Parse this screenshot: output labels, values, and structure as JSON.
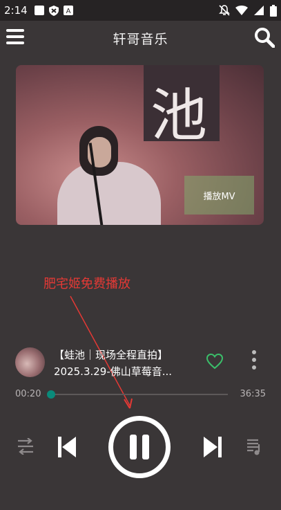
{
  "status_bar": {
    "time": "2:14",
    "left_icons": [
      "square-icon",
      "shield-icon",
      "a-icon"
    ],
    "right_icons": [
      "notifications-off-icon",
      "wifi-icon",
      "signal-icon",
      "battery-icon"
    ]
  },
  "app_bar": {
    "title": "轩哥音乐",
    "menu_icon": "hamburger-menu-icon",
    "search_icon": "search-icon"
  },
  "cover": {
    "sign_text": "池",
    "mv_button_label": "播放MV"
  },
  "annotation": {
    "text": "肥宅姬免费播放",
    "color": "#e53935"
  },
  "now_playing": {
    "title": "【蛙池｜现场全程直拍】",
    "subtitle": "2025.3.29-佛山草莓音...",
    "favorite_icon": "heart-outline-icon",
    "more_icon": "more-vertical-icon"
  },
  "progress": {
    "current_time": "00:20",
    "total_time": "36:35",
    "fraction": 0.009,
    "accent_color": "#0a8a7a"
  },
  "controls": {
    "repeat_icon": "repeat-icon",
    "previous_icon": "skip-previous-icon",
    "play_pause_icon": "pause-icon",
    "next_icon": "skip-next-icon",
    "playlist_icon": "playlist-icon"
  }
}
